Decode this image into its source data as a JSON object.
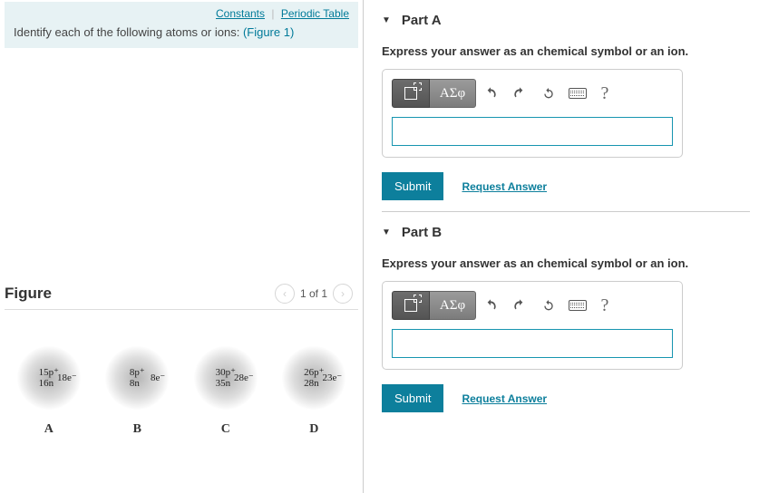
{
  "header": {
    "constants": "Constants",
    "periodic": "Periodic Table"
  },
  "prompt": {
    "text": "Identify each of the following atoms or ions:",
    "figref": "(Figure 1)"
  },
  "figure": {
    "title": "Figure",
    "pager": "1 of 1",
    "atoms": [
      {
        "p": "15p⁺",
        "n": "16n",
        "e": "18e⁻",
        "label": "A"
      },
      {
        "p": "8p⁺",
        "n": "8n",
        "e": "8e⁻",
        "label": "B"
      },
      {
        "p": "30p⁺",
        "n": "35n",
        "e": "28e⁻",
        "label": "C"
      },
      {
        "p": "26p⁺",
        "n": "28n",
        "e": "23e⁻",
        "label": "D"
      }
    ]
  },
  "answer_common": {
    "instruction": "Express your answer as an chemical symbol or an ion.",
    "greek": "ΑΣφ",
    "help": "?",
    "submit": "Submit",
    "request": "Request Answer"
  },
  "parts": {
    "a": {
      "title": "Part A"
    },
    "b": {
      "title": "Part B"
    }
  }
}
